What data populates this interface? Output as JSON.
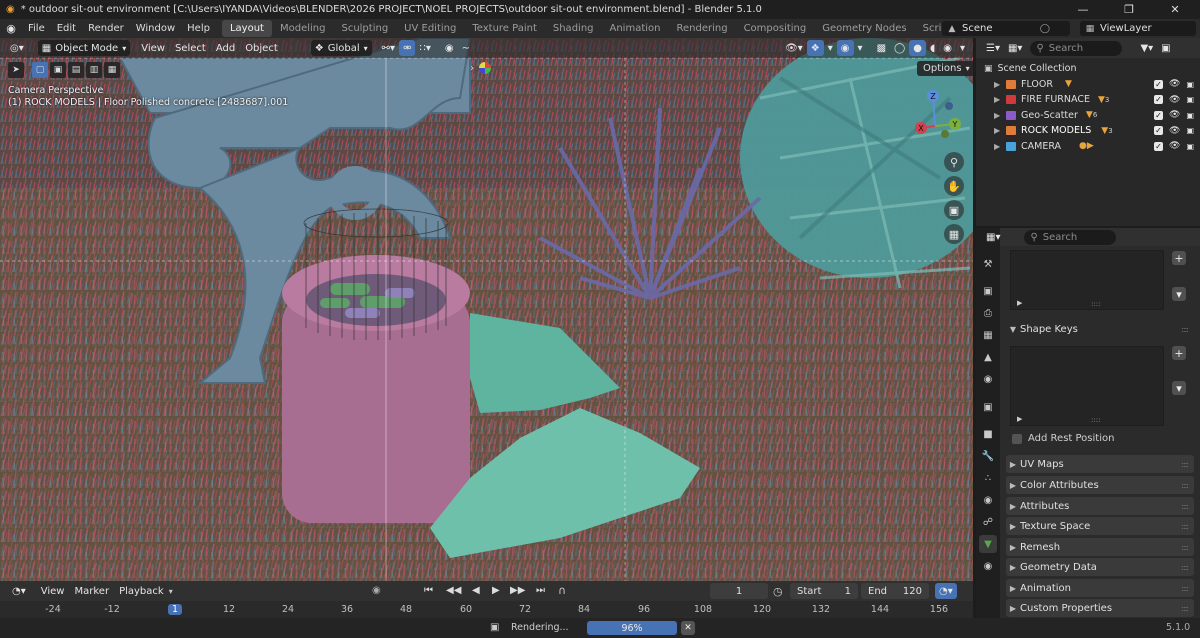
{
  "window": {
    "title": "* outdoor sit-out environment [C:\\Users\\IYANDA\\Videos\\BLENDER\\2026 PROJECT\\NOEL PROJECTS\\outdoor sit-out environment.blend] - Blender 5.1.0",
    "controls": [
      "—",
      "❐",
      "✕"
    ]
  },
  "menu": [
    "File",
    "Edit",
    "Render",
    "Window",
    "Help"
  ],
  "workspaces": [
    "Layout",
    "Modeling",
    "Sculpting",
    "UV Editing",
    "Texture Paint",
    "Shading",
    "Animation",
    "Rendering",
    "Compositing",
    "Geometry Nodes",
    "Scripting"
  ],
  "active_workspace": "Layout",
  "scene": "Scene",
  "view_layer": "ViewLayer",
  "viewport": {
    "mode": "Object Mode",
    "menus": [
      "View",
      "Select",
      "Add",
      "Object"
    ],
    "transform_orientation": "Global",
    "camera_label": "Camera Perspective",
    "active_info": "(1) ROCK MODELS | Floor Polished concrete [2483687].001",
    "options": "Options",
    "gizmo_axes": [
      "Z",
      "Y",
      "X"
    ]
  },
  "outliner": {
    "search_placeholder": "Search",
    "root": "Scene Collection",
    "collections": [
      {
        "name": "FLOOR",
        "color": "#e07b39"
      },
      {
        "name": "FIRE FURNACE",
        "color": "#cf3b3b",
        "sub": "3"
      },
      {
        "name": "Geo-Scatter",
        "color": "#8b5cc7",
        "sub": "6"
      },
      {
        "name": "ROCK MODELS",
        "color": "#e07b39",
        "sub": "3"
      },
      {
        "name": "CAMERA",
        "color": "#4aa3d8"
      }
    ]
  },
  "properties": {
    "search_placeholder": "Search",
    "shape_keys": "Shape Keys",
    "add_rest_position": "Add Rest Position",
    "panels": [
      "UV Maps",
      "Color Attributes",
      "Attributes",
      "Texture Space",
      "Remesh",
      "Geometry Data",
      "Animation",
      "Custom Properties"
    ]
  },
  "timeline": {
    "menus": [
      "View",
      "Marker",
      "Playback"
    ],
    "current_frame": "1",
    "start_label": "Start",
    "start": "1",
    "end_label": "End",
    "end": "120",
    "ticks": [
      "-24",
      "-12",
      "1",
      "12",
      "24",
      "36",
      "48",
      "60",
      "72",
      "84",
      "96",
      "108",
      "120",
      "132",
      "144",
      "156"
    ]
  },
  "status": {
    "rendering_label": "Rendering...",
    "progress": "96%",
    "progress_value": 0.96,
    "version": "5.1.0"
  }
}
